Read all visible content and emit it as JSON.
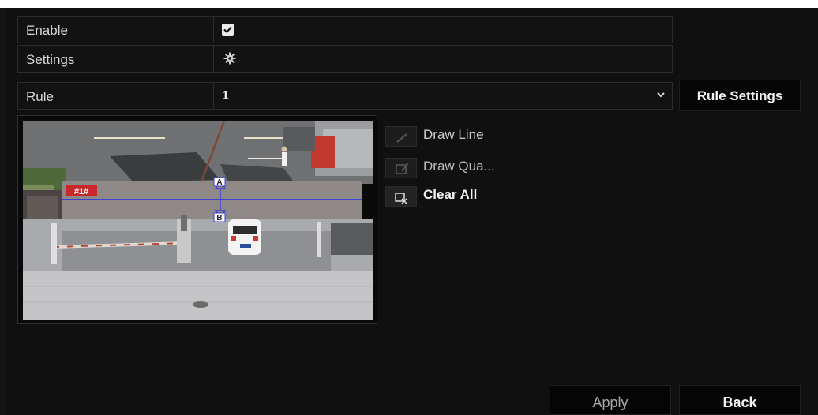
{
  "form": {
    "enable_label": "Enable",
    "enable_checked": true,
    "settings_label": "Settings",
    "rule_label": "Rule",
    "rule_value": "1"
  },
  "buttons": {
    "rule_settings": "Rule Settings",
    "apply": "Apply",
    "back": "Back"
  },
  "tools": {
    "draw_line": "Draw Line",
    "draw_quad": "Draw Qua...",
    "clear_all": "Clear All"
  },
  "preview": {
    "region_tag": "#1#",
    "marker_a": "A",
    "marker_b": "B"
  },
  "icons": {
    "settings": "gear-icon",
    "dropdown": "chevron-down-icon",
    "draw_line": "line-icon",
    "draw_quad": "polygon-icon",
    "clear_all": "clear-icon"
  }
}
